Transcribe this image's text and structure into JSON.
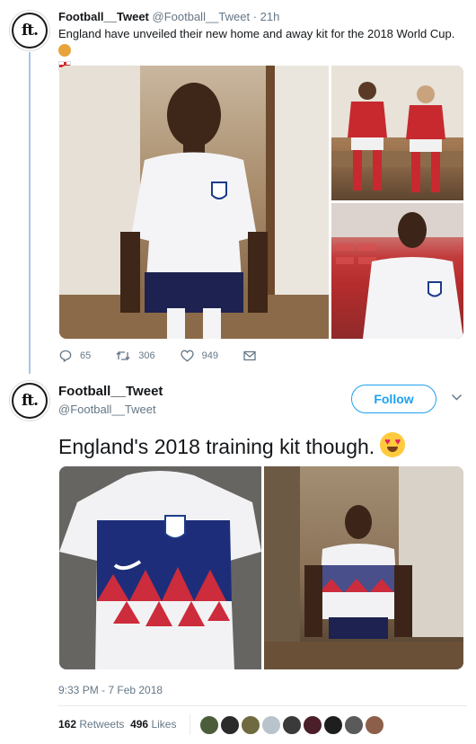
{
  "tweet1": {
    "display_name": "Football__Tweet",
    "handle": "@Football__Tweet",
    "time": "· 21h",
    "text": "England have unveiled their new home and away kit for the 2018 World Cup.",
    "actions": {
      "replies": "65",
      "retweets": "306",
      "likes": "949"
    }
  },
  "tweet2": {
    "display_name": "Football__Tweet",
    "handle": "@Football__Tweet",
    "follow_label": "Follow",
    "text": "England's 2018 training kit though.",
    "timestamp": "9:33 PM - 7 Feb 2018",
    "retweet_count": "162",
    "retweet_label": "Retweets",
    "like_count": "496",
    "like_label": "Likes"
  },
  "avatar_logo": "ft.",
  "liker_colors": [
    "#4b5d3a",
    "#2b2b2b",
    "#6f6a3f",
    "#b9c3cc",
    "#3a3a3a",
    "#4a1f2a",
    "#1e1e1e",
    "#5a5a5a",
    "#8c5f4a"
  ],
  "colors": {
    "accent": "#1da1f2",
    "secondary_text": "#657786",
    "thread_line": "#a8c6e4"
  }
}
